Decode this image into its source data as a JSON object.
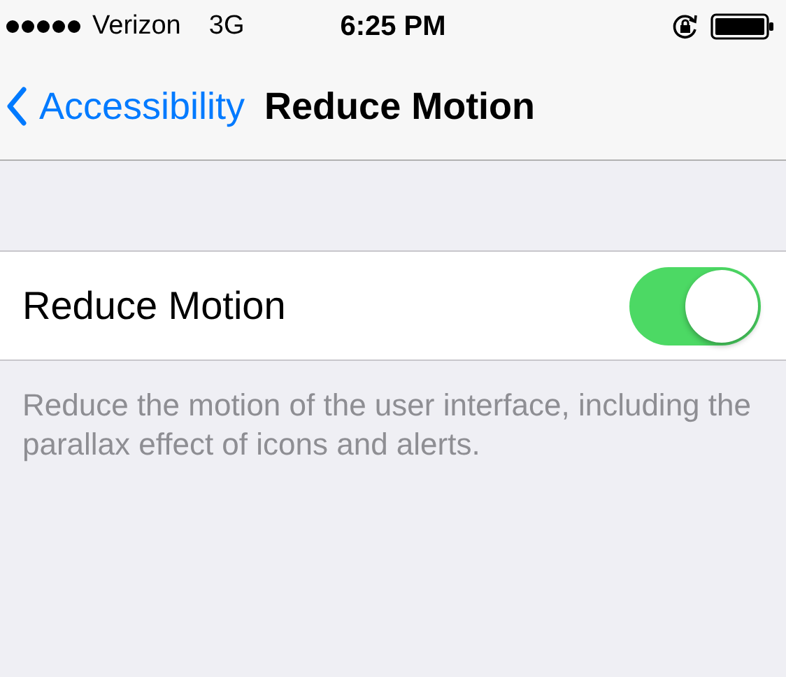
{
  "status_bar": {
    "carrier": "Verizon",
    "network": "3G",
    "time": "6:25 PM"
  },
  "nav": {
    "back": "Accessibility",
    "title": "Reduce Motion"
  },
  "settings": [
    {
      "label": "Reduce Motion",
      "kind": "toggle",
      "on": true
    }
  ],
  "footer": "Reduce the motion of the user interface, including the parallax effect of icons and alerts."
}
